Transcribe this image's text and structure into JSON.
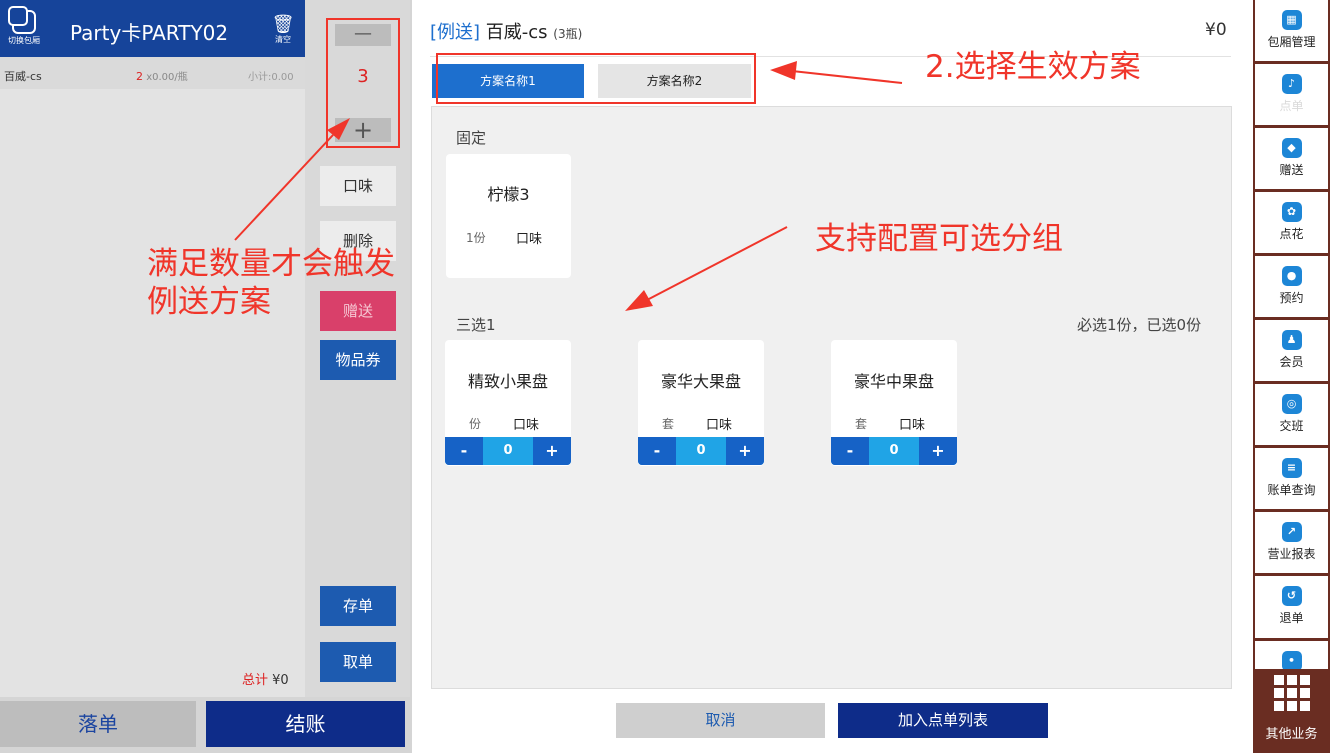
{
  "left_panel": {
    "switch_room_label": "切换包厢",
    "room_name": "Party卡PARTY02",
    "clear_label": "清空",
    "order_item": {
      "name": "百威-cs",
      "qty": "2",
      "price": "x0.00/瓶",
      "subtotal": "小计:0.00"
    },
    "total_label": "总计",
    "total_value": "¥0",
    "place_order": "落单",
    "checkout": "结账"
  },
  "mid_column": {
    "minus": "—",
    "quantity": "3",
    "plus": "+",
    "flavor": "口味",
    "delete": "删除",
    "gift": "赠送",
    "voucher": "物品券",
    "save": "存单",
    "retrieve": "取单"
  },
  "dialog": {
    "tag": "[例送]",
    "product": "百威-cs",
    "unit_note": "(3瓶)",
    "price": "¥0",
    "tabs": [
      {
        "label": "方案名称1",
        "active": true
      },
      {
        "label": "方案名称2",
        "active": false
      }
    ],
    "fixed_group": {
      "label": "固定",
      "item": {
        "name": "柠檬3",
        "unit": "1份",
        "flavor": "口味"
      }
    },
    "optional_group": {
      "label": "三选1",
      "rule": "必选1份，已选0份",
      "items": [
        {
          "name": "精致小果盘",
          "unit": "份",
          "flavor": "口味",
          "qty": "0"
        },
        {
          "name": "豪华大果盘",
          "unit": "套",
          "flavor": "口味",
          "qty": "0"
        },
        {
          "name": "豪华中果盘",
          "unit": "套",
          "flavor": "口味",
          "qty": "0"
        }
      ]
    },
    "stepper_minus": "-",
    "stepper_plus": "+",
    "cancel": "取消",
    "add_to_list": "加入点单列表"
  },
  "annotations": {
    "a1": "满足数量才会触发例送方案",
    "a2": "2.选择生效方案",
    "a3": "支持配置可选分组",
    "color": "#f0352a"
  },
  "right_nav": {
    "items": [
      {
        "label": "包厢管理",
        "icon": "room-icon"
      },
      {
        "label": "点单",
        "icon": "order-icon"
      },
      {
        "label": "赠送",
        "icon": "gift-icon"
      },
      {
        "label": "点花",
        "icon": "flower-icon"
      },
      {
        "label": "预约",
        "icon": "reserve-icon"
      },
      {
        "label": "会员",
        "icon": "member-icon"
      },
      {
        "label": "交班",
        "icon": "shift-icon"
      },
      {
        "label": "账单查询",
        "icon": "bill-icon"
      },
      {
        "label": "营业报表",
        "icon": "report-icon"
      },
      {
        "label": "退单",
        "icon": "refund-icon"
      }
    ],
    "more": "其他业务"
  },
  "colors": {
    "primary": "#1d6fce",
    "dark_blue": "#0e2c89",
    "nav_bg": "#6a2d22",
    "gift": "#d9406a"
  }
}
